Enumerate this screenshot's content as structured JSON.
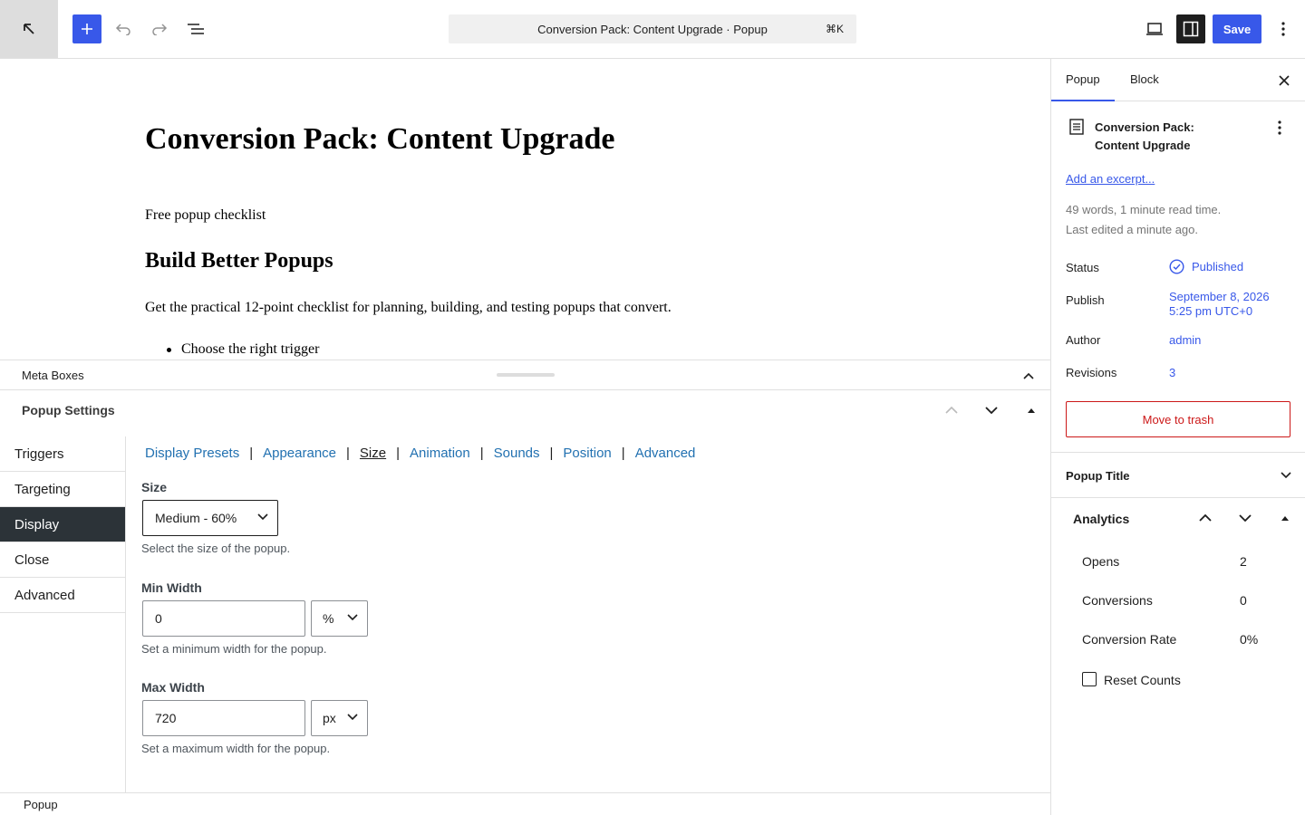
{
  "toolbar": {
    "document_title": "Conversion Pack: Content Upgrade · Popup",
    "shortcut": "⌘K",
    "save_label": "Save"
  },
  "editor": {
    "post_title": "Conversion Pack: Content Upgrade",
    "intro": "Free popup checklist",
    "heading": "Build Better Popups",
    "body": "Get the practical 12-point checklist for planning, building, and testing popups that convert.",
    "list_items": [
      "Choose the right trigger"
    ]
  },
  "meta_boxes": {
    "label": "Meta Boxes",
    "panel_title": "Popup Settings",
    "vertical_tabs": [
      {
        "label": "Triggers",
        "active": false
      },
      {
        "label": "Targeting",
        "active": false
      },
      {
        "label": "Display",
        "active": true
      },
      {
        "label": "Close",
        "active": false
      },
      {
        "label": "Advanced",
        "active": false
      }
    ],
    "sub_tabs": [
      {
        "label": "Display Presets",
        "current": false
      },
      {
        "label": "Appearance",
        "current": false
      },
      {
        "label": "Size",
        "current": true
      },
      {
        "label": "Animation",
        "current": false
      },
      {
        "label": "Sounds",
        "current": false
      },
      {
        "label": "Position",
        "current": false
      },
      {
        "label": "Advanced",
        "current": false
      }
    ],
    "size": {
      "label": "Size",
      "value": "Medium - 60%",
      "description": "Select the size of the popup."
    },
    "min_width": {
      "label": "Min Width",
      "value": "0",
      "unit": "%",
      "description": "Set a minimum width for the popup."
    },
    "max_width": {
      "label": "Max Width",
      "value": "720",
      "unit": "px",
      "description": "Set a maximum width for the popup."
    }
  },
  "footer": {
    "breadcrumb": "Popup"
  },
  "sidebar": {
    "tabs": [
      {
        "label": "Popup",
        "active": true
      },
      {
        "label": "Block",
        "active": false
      }
    ],
    "doc_title_line1": "Conversion Pack:",
    "doc_title_line2": "Content Upgrade",
    "excerpt_link": "Add an excerpt...",
    "word_count": "49 words, 1 minute read time.",
    "last_edited": "Last edited a minute ago.",
    "status_label": "Status",
    "status_value": "Published",
    "publish_label": "Publish",
    "publish_line1": "September 8, 2026",
    "publish_line2": "5:25 pm UTC+0",
    "author_label": "Author",
    "author_value": "admin",
    "revisions_label": "Revisions",
    "revisions_value": "3",
    "trash_label": "Move to trash",
    "popup_title_panel": "Popup Title",
    "analytics": {
      "title": "Analytics",
      "opens_label": "Opens",
      "opens_value": "2",
      "conversions_label": "Conversions",
      "conversions_value": "0",
      "rate_label": "Conversion Rate",
      "rate_value": "0%",
      "reset_label": "Reset Counts"
    }
  },
  "colors": {
    "accent": "#3858e9",
    "link": "#2271b1",
    "danger": "#cc1818",
    "active_tab_bg": "#2c3338"
  }
}
